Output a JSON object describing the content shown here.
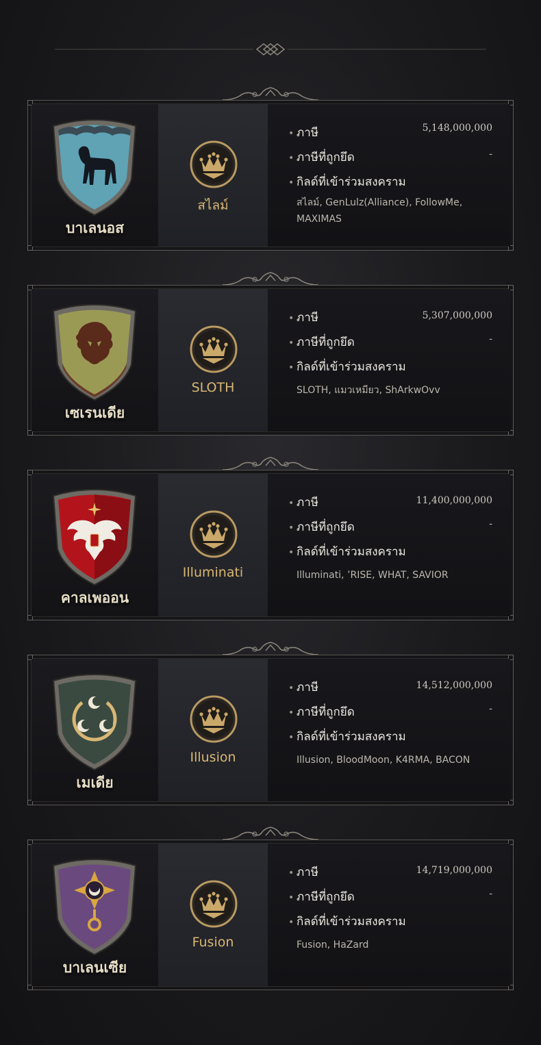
{
  "labels": {
    "tax": "ภาษี",
    "seized_tax": "ภาษีที่ถูกยึด",
    "participating_guilds": "กิลด์ที่เข้าร่วมสงคราม"
  },
  "territories": [
    {
      "name": "บาเลนอส",
      "emblem": "horse-icon",
      "shield_color": "#5fa3b5",
      "occupying_guild": "สไลม์",
      "tax": "5,148,000,000",
      "seized_tax": "-",
      "guilds": "สไลม์,  GenLulz(Alliance), FollowMe, MAXIMAS"
    },
    {
      "name": "เซเรนเดีย",
      "emblem": "lion-icon",
      "shield_color": "#9a9a55",
      "occupying_guild": "SLOTH",
      "tax": "5,307,000,000",
      "seized_tax": "-",
      "guilds": "SLOTH,  แมวเหมียว, ShArkwOvv"
    },
    {
      "name": "คาลเพออน",
      "emblem": "eagle-icon",
      "shield_color": "#a8141c",
      "occupying_guild": "Illuminati",
      "tax": "11,400,000,000",
      "seized_tax": "-",
      "guilds": "Illuminati, ’RISE, WHAT, SAVIOR"
    },
    {
      "name": "เมเดีย",
      "emblem": "crescent-moons-icon",
      "shield_color": "#3a4a40",
      "occupying_guild": "Illusion",
      "tax": "14,512,000,000",
      "seized_tax": "-",
      "guilds": "Illusion, BloodMoon, K4RMA, BACON"
    },
    {
      "name": "บาเลนเซีย",
      "emblem": "eye-sun-icon",
      "shield_color": "#6a4a7e",
      "occupying_guild": "Fusion",
      "tax": "14,719,000,000",
      "seized_tax": "-",
      "guilds": "Fusion, HaZard"
    }
  ]
}
